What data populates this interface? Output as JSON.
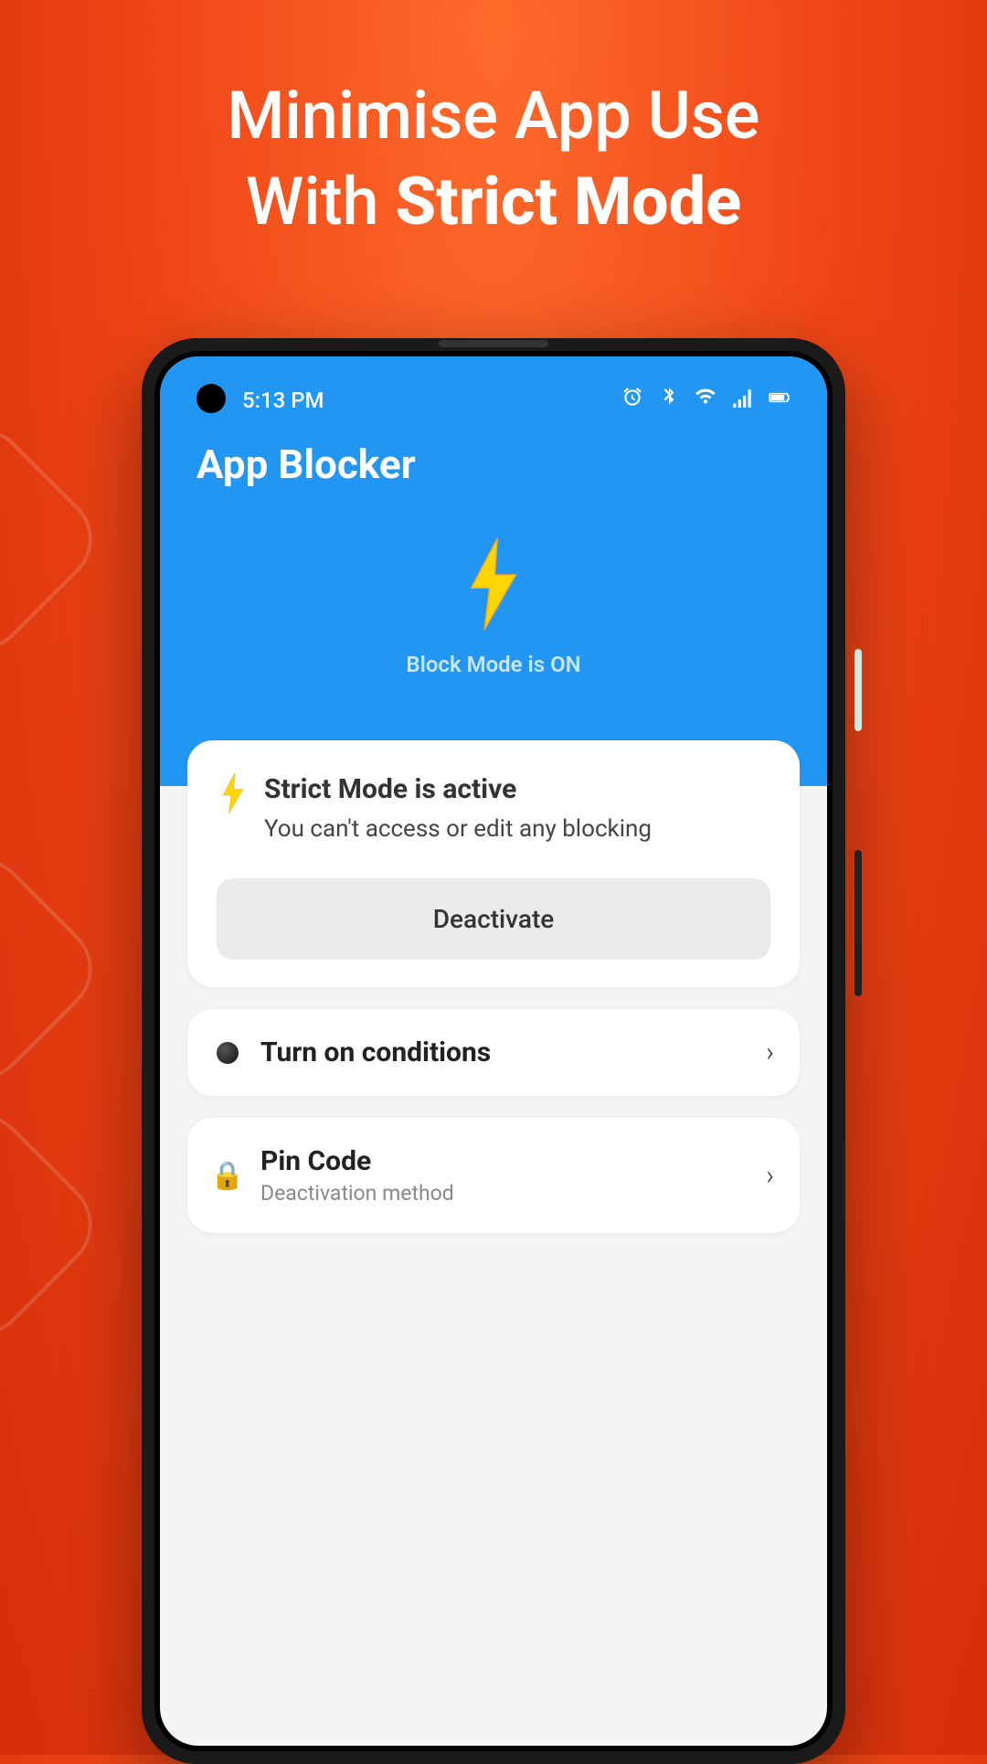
{
  "promo": {
    "line1": "Minimise App Use",
    "line2_prefix": "With ",
    "line2_bold": "Strict Mode"
  },
  "status_bar": {
    "time": "5:13 PM"
  },
  "header": {
    "app_title": "App Blocker",
    "block_mode_label": "Block Mode is ON"
  },
  "strict_card": {
    "title": "Strict Mode is active",
    "subtitle": "You can't access or edit any blocking",
    "deactivate_label": "Deactivate"
  },
  "items": {
    "conditions": {
      "title": "Turn on conditions"
    },
    "pin": {
      "title": "Pin Code",
      "subtitle": "Deactivation method"
    }
  }
}
